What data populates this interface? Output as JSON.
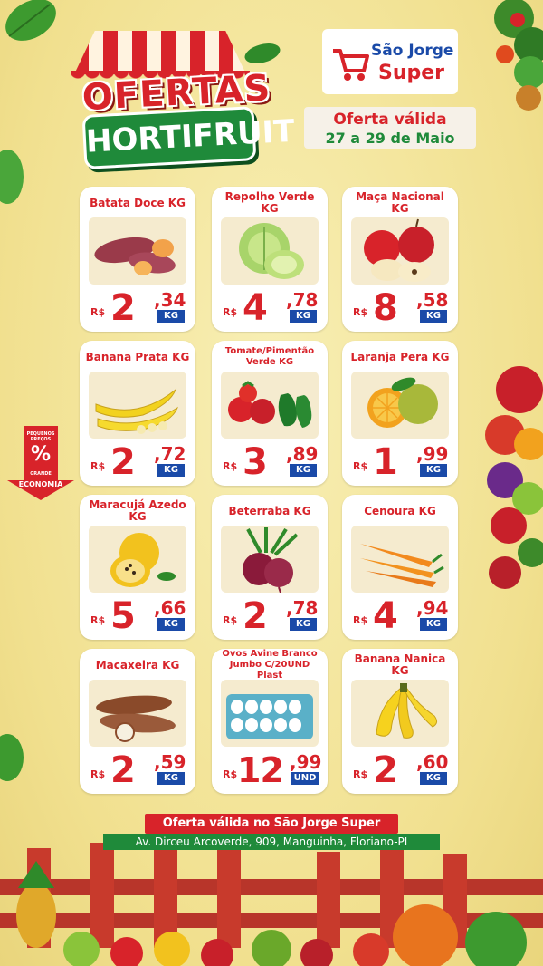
{
  "header": {
    "title_line1": "OFERTAS DO",
    "title_line2": "HORTIFRUIT",
    "logo_line1": "São Jorge",
    "logo_line2": "Super",
    "validity_title": "Oferta válida",
    "validity_dates": "27 a 29 de Maio"
  },
  "badge": {
    "line1": "PEQUENOS PREÇOS",
    "symbol": "%",
    "line2": "GRANDE",
    "line3": "ECONOMIA"
  },
  "currency": "R$",
  "products": [
    {
      "name": "Batata Doce KG",
      "int": "2",
      "cents": ",34",
      "unit": "KG",
      "icon": "sweet-potato-icon"
    },
    {
      "name": "Repolho Verde KG",
      "int": "4",
      "cents": ",78",
      "unit": "KG",
      "icon": "cabbage-icon"
    },
    {
      "name": "Maça Nacional KG",
      "int": "8",
      "cents": ",58",
      "unit": "KG",
      "icon": "apple-icon"
    },
    {
      "name": "Banana Prata KG",
      "int": "2",
      "cents": ",72",
      "unit": "KG",
      "icon": "banana-icon"
    },
    {
      "name": "Tomate/Pimentão Verde KG",
      "int": "3",
      "cents": ",89",
      "unit": "KG",
      "icon": "tomato-pepper-icon"
    },
    {
      "name": "Laranja Pera KG",
      "int": "1",
      "cents": ",99",
      "unit": "KG",
      "icon": "orange-icon"
    },
    {
      "name": "Maracujá Azedo KG",
      "int": "5",
      "cents": ",66",
      "unit": "KG",
      "icon": "passion-fruit-icon"
    },
    {
      "name": "Beterraba KG",
      "int": "2",
      "cents": ",78",
      "unit": "KG",
      "icon": "beet-icon"
    },
    {
      "name": "Cenoura KG",
      "int": "4",
      "cents": ",94",
      "unit": "KG",
      "icon": "carrot-icon"
    },
    {
      "name": "Macaxeira KG",
      "int": "2",
      "cents": ",59",
      "unit": "KG",
      "icon": "cassava-icon"
    },
    {
      "name": "Ovos Avine Branco Jumbo C/20UND Plast",
      "int": "12",
      "cents": ",99",
      "unit": "UND",
      "icon": "eggs-icon"
    },
    {
      "name": "Banana Nanica KG",
      "int": "2",
      "cents": ",60",
      "unit": "KG",
      "icon": "banana-bunch-icon"
    }
  ],
  "footer": {
    "line1": "Oferta válida no São Jorge Super",
    "line2": "Av. Dirceu Arcoverde, 909, Manguinha, Floriano-PI"
  },
  "colors": {
    "background": "#f3e59a",
    "brand_red": "#d8232a",
    "brand_green": "#1f8a3a",
    "brand_blue": "#1a4aa8"
  }
}
